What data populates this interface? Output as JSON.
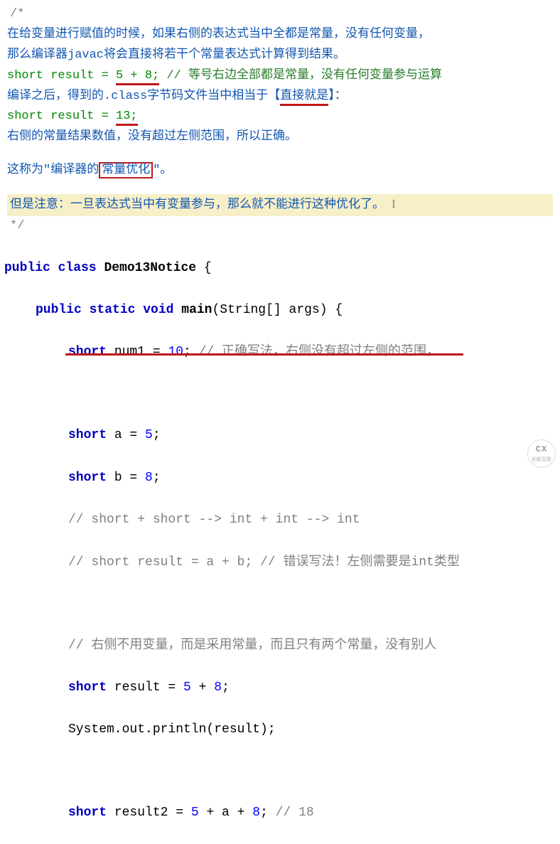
{
  "explanation": {
    "opener": "/*",
    "line1": "在给变量进行赋值的时候，如果右侧的表达式当中全都是常量，没有任何变量，",
    "line2": "那么编译器javac将会直接将若干个常量表达式计算得到结果。",
    "code1_a": "short result = ",
    "code1_b": "5 + 8;",
    "code1_c": " // 等号右边全部都是常量，没有任何变量参与运算",
    "line3a": "编译之后，得到的.class字节码文件当中相当于【",
    "line3b": "直接就是",
    "line3c": "】：",
    "code2_a": "short result = ",
    "code2_b": "13;",
    "line4": "右侧的常量结果数值，没有超过左侧范围，所以正确。",
    "line5a": "这称为\"编译器的",
    "line5b": "常量优化",
    "line5c": "\"。",
    "highlight": "但是注意：一旦表达式当中有变量参与，那么就不能进行这种优化了。",
    "closer": "*/"
  },
  "code": {
    "l1_kw1": "public",
    "l1_kw2": "class",
    "l1_cls": "Demo13Notice",
    "l1_brace": " {",
    "l2_kw1": "public",
    "l2_kw2": "static",
    "l2_kw3": "void",
    "l2_fn": "main",
    "l2_args": "(String[] args) {",
    "l3_kw": "short",
    "l3_id": " num1 = ",
    "l3_num": "10",
    "l3_semi": "; ",
    "l3_cm": "// 正确写法，右侧没有超过左侧的范围，",
    "l4_a": "short",
    "l4_b": " a = ",
    "l4_num": "5",
    "l4_semi": ";",
    "l5_a": "short",
    "l5_b": " b = ",
    "l5_num": "8",
    "l5_semi": ";",
    "l6_cm": "// short + short --> int + int --> int",
    "l7_cm": "// short result = a + b; // 错误写法！左侧需要是int类型",
    "l8_cm": "// 右侧不用变量，而是采用常量，而且只有两个常量，没有别人",
    "l9_a": "short",
    "l9_b": " result = ",
    "l9_n1": "5",
    "l9_op": " + ",
    "l9_n2": "8",
    "l9_semi": ";",
    "l10": "System.out.println(result);",
    "l11_a": "short",
    "l11_b": " result2 = ",
    "l11_n1": "5",
    "l11_op1": " + a + ",
    "l11_n2": "8",
    "l11_semi": "; ",
    "l11_cm": "// 18"
  },
  "watermark": {
    "main": "CX",
    "sub": "创新互联"
  }
}
